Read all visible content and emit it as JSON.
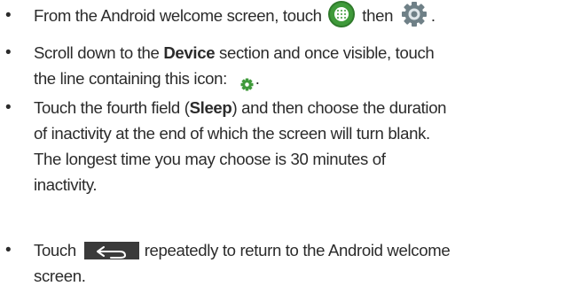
{
  "bullets": [
    {
      "symbol": "•",
      "line1_before": "From the Android welcome screen, touch ",
      "line1_mid": " then ",
      "line1_after": "."
    },
    {
      "symbol": "•",
      "line1_before": "Scroll down to the ",
      "line1_bold": "Device",
      "line1_after": " section and once visible, touch",
      "line2_before": "the line containing this icon: ",
      "line2_after": "."
    },
    {
      "symbol": "•",
      "line1_before": "Touch the fourth field (",
      "line1_bold": "Sleep",
      "line1_after": ") and then choose the duration",
      "line2": "of inactivity at the end of which the screen will turn blank.",
      "line3": "The longest time you may choose is 30 minutes of",
      "line4": "inactivity."
    },
    {
      "symbol": "•",
      "line1_before": "Touch ",
      "line1_after": "repeatedly to return to the Android welcome",
      "line2": "screen."
    }
  ],
  "icons": {
    "apps": "apps-icon",
    "settings": "settings-gear-icon",
    "device_settings": "settings-gear-icon",
    "back": "back-arrow-icon"
  },
  "colors": {
    "text": "#2b2b2b",
    "apps_green": "#3f9a3a",
    "gear_gray": "#6f8087",
    "gear_green": "#3f9a3a",
    "back_button": "#3a3a3a"
  }
}
